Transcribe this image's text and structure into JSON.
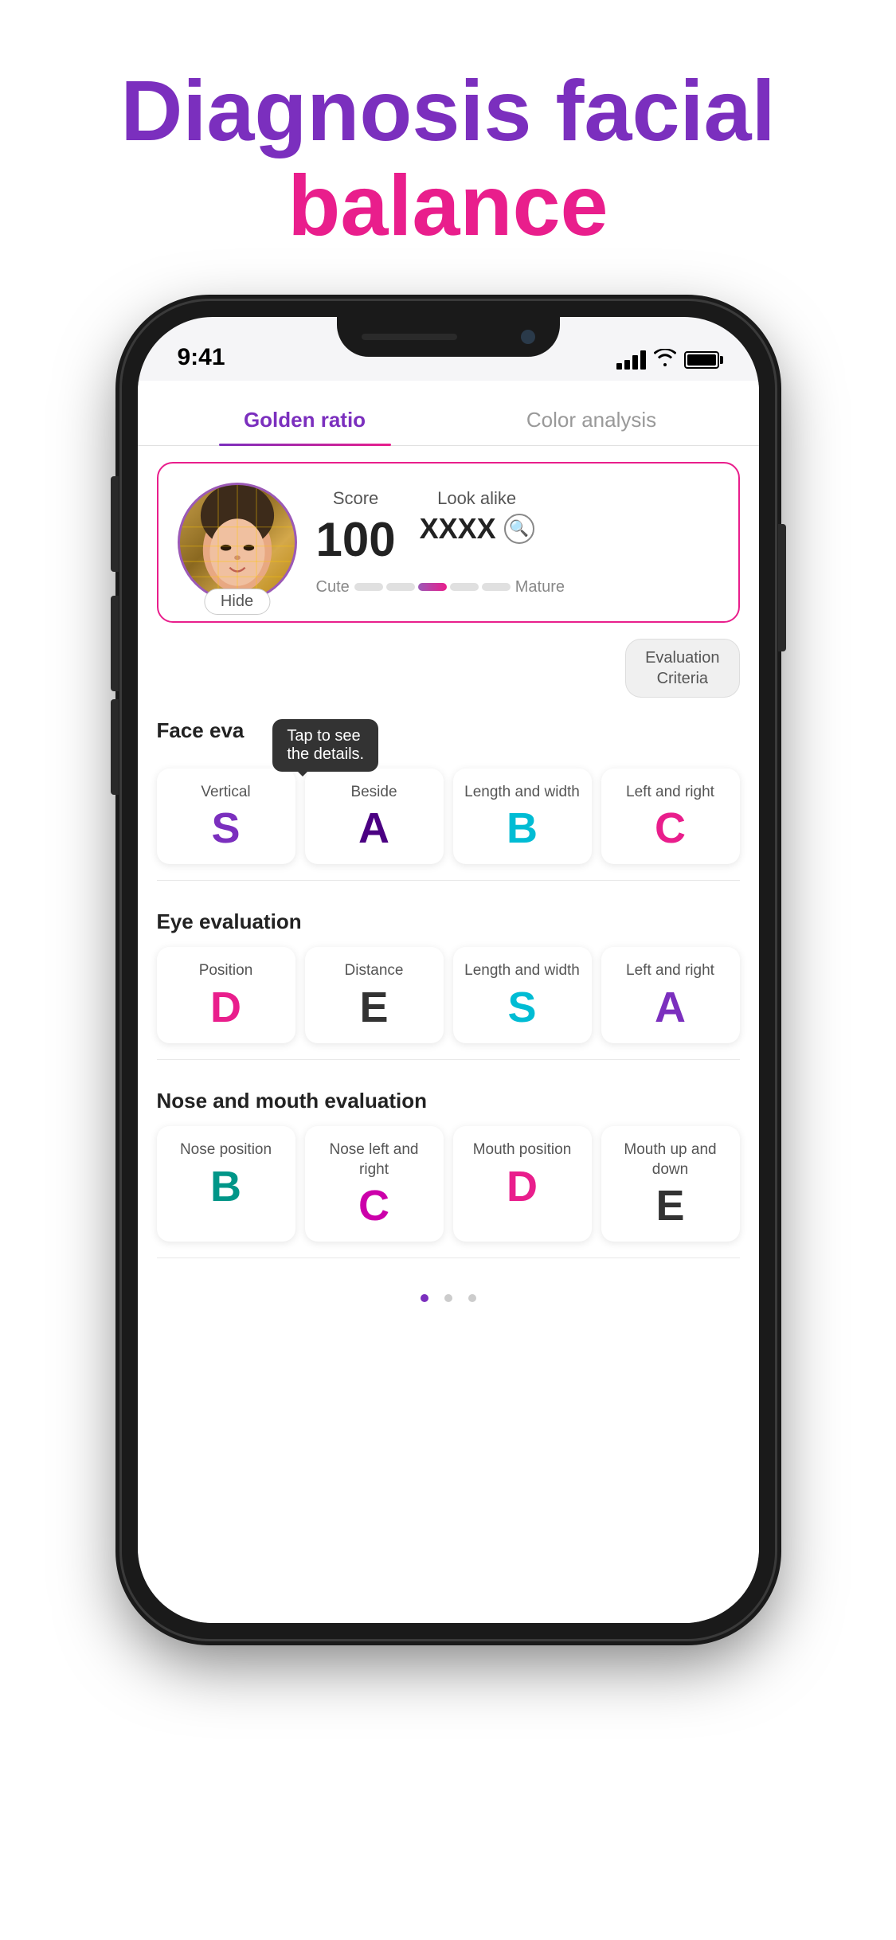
{
  "hero": {
    "line1": "Diagnosis facial",
    "line2": "balance"
  },
  "phone": {
    "statusBar": {
      "time": "9:41",
      "signal": "4 bars",
      "wifi": true,
      "battery": "full"
    },
    "tabs": [
      {
        "id": "golden",
        "label": "Golden ratio",
        "active": true
      },
      {
        "id": "color",
        "label": "Color analysis",
        "active": false
      }
    ],
    "scoreCard": {
      "hideLabel": "Hide",
      "scoreLabel": "Score",
      "scoreValue": "100",
      "lookAlikeLabel": "Look alike",
      "lookAlikeValue": "XXXX",
      "cuteLabel": "Cute",
      "matureLabel": "Mature"
    },
    "evalCriteriaBtn": "Evaluation\nCriteria",
    "tooltipText": "Tap to see\nthe details.",
    "faceEval": {
      "title": "Face eva",
      "cards": [
        {
          "label": "Vertical",
          "grade": "S",
          "colorClass": "grade-purple"
        },
        {
          "label": "Beside",
          "grade": "A",
          "colorClass": "grade-darkpurple"
        },
        {
          "label": "Length and width",
          "grade": "B",
          "colorClass": "grade-cyan"
        },
        {
          "label": "Left and right",
          "grade": "C",
          "colorClass": "grade-pink"
        }
      ]
    },
    "eyeEval": {
      "title": "Eye evaluation",
      "cards": [
        {
          "label": "Position",
          "grade": "D",
          "colorClass": "grade-pink"
        },
        {
          "label": "Distance",
          "grade": "E",
          "colorClass": "grade-dark"
        },
        {
          "label": "Length and width",
          "grade": "S",
          "colorClass": "grade-cyan"
        },
        {
          "label": "Left and right",
          "grade": "A",
          "colorClass": "grade-purple"
        }
      ]
    },
    "noseMouthEval": {
      "title": "Nose and mouth evaluation",
      "cards": [
        {
          "label": "Nose position",
          "grade": "B",
          "colorClass": "grade-teal"
        },
        {
          "label": "Nose left and right",
          "grade": "C",
          "colorClass": "grade-magenta"
        },
        {
          "label": "Mouth position",
          "grade": "D",
          "colorClass": "grade-pink"
        },
        {
          "label": "Mouth up and down",
          "grade": "E",
          "colorClass": "grade-dark"
        }
      ]
    }
  }
}
